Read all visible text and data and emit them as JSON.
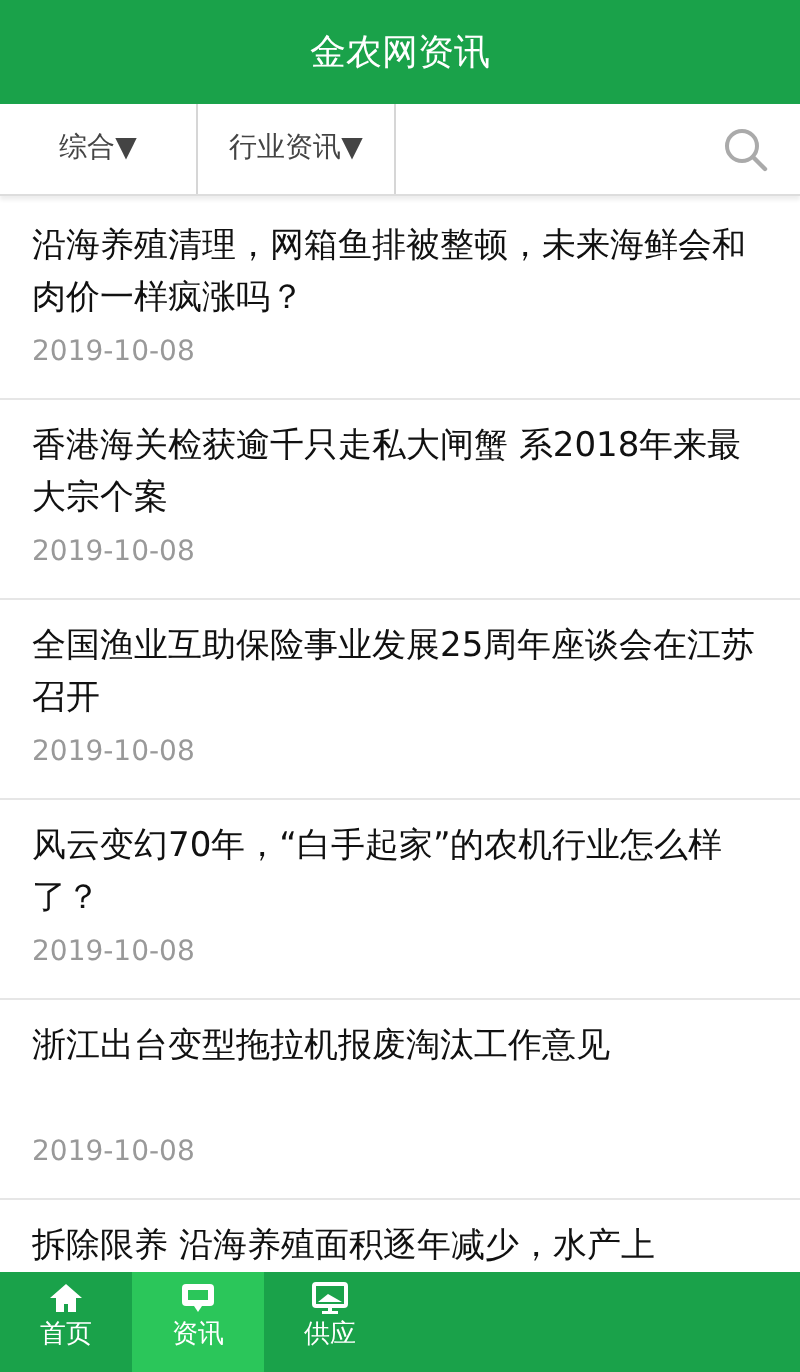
{
  "header": {
    "title": "金农网资讯"
  },
  "filters": [
    {
      "label": "综合",
      "caret": "▼"
    },
    {
      "label": "行业资讯",
      "caret": "▼"
    }
  ],
  "articles": [
    {
      "title": "沿海养殖清理，网箱鱼排被整顿，未来海鲜会和肉价一样疯涨吗？",
      "date": "2019-10-08"
    },
    {
      "title": "香港海关检获逾千只走私大闸蟹 系2018年来最大宗个案",
      "date": "2019-10-08"
    },
    {
      "title": "全国渔业互助保险事业发展25周年座谈会在江苏召开",
      "date": "2019-10-08"
    },
    {
      "title": "风云变幻70年，“白手起家”的农机行业怎么样了？",
      "date": "2019-10-08"
    },
    {
      "title": "浙江出台变型拖拉机报废淘汰工作意见",
      "date": "2019-10-08"
    },
    {
      "title": "拆除限养 沿海养殖面积逐年减少，水产上"
    }
  ],
  "tabbar": [
    {
      "label": "首页",
      "kind": "home",
      "selected": false
    },
    {
      "label": "资讯",
      "kind": "chat",
      "selected": true
    },
    {
      "label": "供应",
      "kind": "monitor",
      "selected": false
    }
  ]
}
